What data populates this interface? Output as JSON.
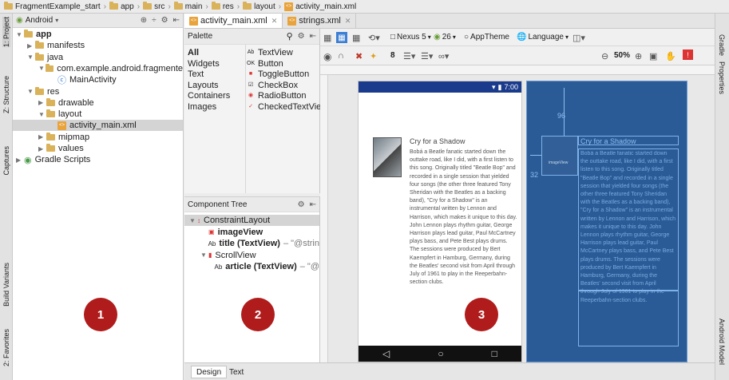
{
  "breadcrumb": [
    "FragmentExample_start",
    "app",
    "src",
    "main",
    "res",
    "layout",
    "activity_main.xml"
  ],
  "left_strip": {
    "project": "1: Project",
    "structure": "Z: Structure",
    "captures": "Captures",
    "build_variants": "Build Variants",
    "favorites": "2: Favorites"
  },
  "right_strip": {
    "gradle": "Gradle",
    "properties": "Properties",
    "android_model": "Android Model"
  },
  "project": {
    "view_selector": "Android",
    "tree": [
      {
        "label": "app",
        "indent": 0,
        "bold": true,
        "expanded": true
      },
      {
        "label": "manifests",
        "indent": 1,
        "expanded": false
      },
      {
        "label": "java",
        "indent": 1,
        "expanded": true
      },
      {
        "label": "com.example.android.fragmente",
        "indent": 2,
        "expanded": true
      },
      {
        "label": "MainActivity",
        "indent": 3
      },
      {
        "label": "res",
        "indent": 1,
        "expanded": true
      },
      {
        "label": "drawable",
        "indent": 2,
        "expanded": false
      },
      {
        "label": "layout",
        "indent": 2,
        "expanded": true
      },
      {
        "label": "activity_main.xml",
        "indent": 3,
        "selected": true
      },
      {
        "label": "mipmap",
        "indent": 2,
        "expanded": false
      },
      {
        "label": "values",
        "indent": 2,
        "expanded": false
      },
      {
        "label": "Gradle Scripts",
        "indent": 0,
        "expanded": false
      }
    ]
  },
  "editor_tabs": [
    {
      "label": "activity_main.xml",
      "active": true
    },
    {
      "label": "strings.xml",
      "active": false
    }
  ],
  "palette": {
    "title": "Palette",
    "categories": [
      "All",
      "Widgets",
      "Text",
      "Layouts",
      "Containers",
      "Images"
    ],
    "items": [
      {
        "label": "TextView",
        "icon": "Ab"
      },
      {
        "label": "Button",
        "icon": "OK"
      },
      {
        "label": "ToggleButton",
        "icon": "toggle"
      },
      {
        "label": "CheckBox",
        "icon": "check"
      },
      {
        "label": "RadioButton",
        "icon": "radio"
      },
      {
        "label": "CheckedTextView",
        "icon": "checked"
      }
    ]
  },
  "component_tree": {
    "title": "Component Tree",
    "nodes": [
      {
        "label": "ConstraintLayout",
        "extra": "",
        "indent": 0
      },
      {
        "label": "imageView",
        "extra": "",
        "indent": 1
      },
      {
        "label": "title (TextView)",
        "extra": "– \"@strin",
        "indent": 1
      },
      {
        "label": "ScrollView",
        "extra": "",
        "indent": 1
      },
      {
        "label": "article (TextView)",
        "extra": "– \"@",
        "indent": 2
      }
    ]
  },
  "toolbar": {
    "device": "Nexus 5",
    "api": "26",
    "theme": "AppTheme",
    "language": "Language",
    "margin": "8",
    "zoom": "50%"
  },
  "preview": {
    "time": "7:00",
    "title": "Cry for a Shadow",
    "article": "Bobá a Beatle fanatic started down the outtake road, like I did, with a first listen to this song. Originally titled \"Beatle Bop\" and recorded in a single session that yielded four songs (the other three featured Tony Sheridan with the Beatles as a backing band), \"Cry for a Shadow\" is an instrumental written by Lennon and Harrison, which makes it unique to this day. John Lennon plays rhythm guitar, George Harrison plays lead guitar, Paul McCartney plays bass, and Pete Best plays drums. The sessions were produced by Bert Kaempfert in Hamburg, Germany, during the Beatles' second visit from April through July of 1961 to play in the Reeperbahn-section clubs."
  },
  "blueprint": {
    "margin_top": "96",
    "margin_left": "32",
    "image_label": "imageView",
    "title": "Cry for a Shadow"
  },
  "bottom_tabs": [
    "Design",
    "Text"
  ],
  "markers": [
    "1",
    "2",
    "3"
  ]
}
